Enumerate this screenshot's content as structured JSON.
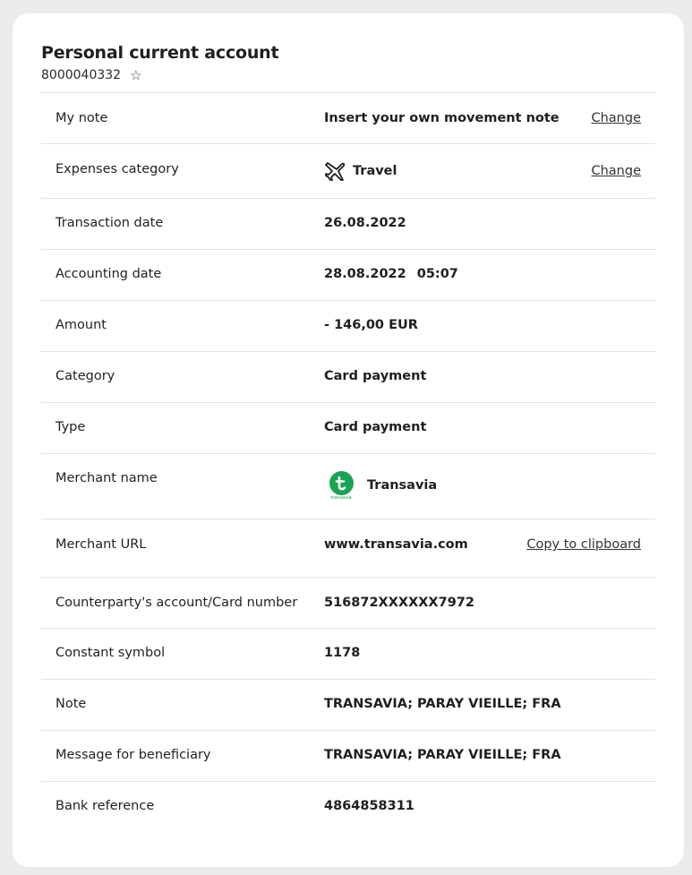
{
  "account": {
    "title": "Personal current account",
    "number": "8000040332",
    "favorite_icon": "star-outline-icon"
  },
  "rows": {
    "my_note": {
      "label": "My note",
      "value": "Insert your own movement note",
      "action": "Change"
    },
    "expenses_category": {
      "label": "Expenses category",
      "value": "Travel",
      "icon": "airplane-icon",
      "action": "Change"
    },
    "transaction_date": {
      "label": "Transaction date",
      "value": "26.08.2022"
    },
    "accounting_date": {
      "label": "Accounting date",
      "date": "28.08.2022",
      "time": "05:07"
    },
    "amount": {
      "label": "Amount",
      "value": "- 146,00 EUR"
    },
    "category": {
      "label": "Category",
      "value": "Card payment"
    },
    "type": {
      "label": "Type",
      "value": "Card payment"
    },
    "merchant_name": {
      "label": "Merchant name",
      "value": "Transavia",
      "logo_text": "transavia",
      "logo_color": "#1aa354"
    },
    "merchant_url": {
      "label": "Merchant URL",
      "value": "www.transavia.com",
      "action": "Copy to clipboard"
    },
    "counterparty": {
      "label": "Counterparty's account/Card number",
      "value": "516872XXXXXX7972"
    },
    "constant_symbol": {
      "label": "Constant symbol",
      "value": "1178"
    },
    "note": {
      "label": "Note",
      "value": "TRANSAVIA; PARAY VIEILLE; FRA"
    },
    "message": {
      "label": "Message for beneficiary",
      "value": "TRANSAVIA; PARAY VIEILLE; FRA"
    },
    "bank_reference": {
      "label": "Bank reference",
      "value": "4864858311"
    }
  }
}
